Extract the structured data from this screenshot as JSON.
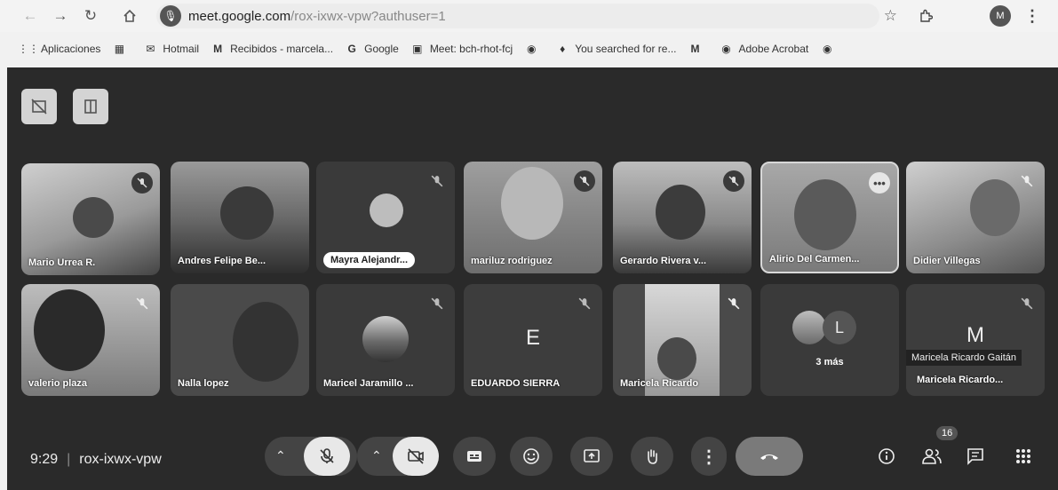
{
  "browser": {
    "url_host": "meet.google.com",
    "url_path": "/rox-ixwx-vpw?authuser=1",
    "profile_initial": "M"
  },
  "bookmarks": [
    {
      "label": "Aplicaciones",
      "icon": "apps-grid-icon"
    },
    {
      "label": "",
      "icon": "grid-icon"
    },
    {
      "label": "Hotmail",
      "icon": "outlook-icon"
    },
    {
      "label": "Recibidos - marcela...",
      "icon": "gmail-icon"
    },
    {
      "label": "Google",
      "icon": "google-icon"
    },
    {
      "label": "Meet: bch-rhot-fcj",
      "icon": "meet-icon"
    },
    {
      "label": "",
      "icon": "globe-icon"
    },
    {
      "label": "You searched for re...",
      "icon": "bookmark-icon"
    },
    {
      "label": "",
      "icon": "gmail-icon"
    },
    {
      "label": "Adobe Acrobat",
      "icon": "globe-icon"
    },
    {
      "label": "",
      "icon": "globe-icon"
    }
  ],
  "participants": [
    {
      "name": "Mario Urrea R."
    },
    {
      "name": "Andres Felipe Be..."
    },
    {
      "name": "Mayra Alejandr..."
    },
    {
      "name": "mariluz rodriguez"
    },
    {
      "name": "Gerardo Rivera v..."
    },
    {
      "name": "Alirio Del Carmen..."
    },
    {
      "name": "Didier Villegas"
    },
    {
      "name": "valerio plaza"
    },
    {
      "name": "Nalla lopez"
    },
    {
      "name": "Maricel Jaramillo ..."
    },
    {
      "name": "EDUARDO SIERRA",
      "initial": "E"
    },
    {
      "name": "Maricela Ricardo"
    },
    {
      "name": "3 más",
      "initial": "L"
    },
    {
      "name": "Maricela Ricardo...",
      "initial": "M",
      "tooltip": "Maricela Ricardo Gaitán"
    }
  ],
  "meeting": {
    "time": "9:29",
    "code": "rox-ixwx-vpw",
    "participant_count": "16"
  }
}
